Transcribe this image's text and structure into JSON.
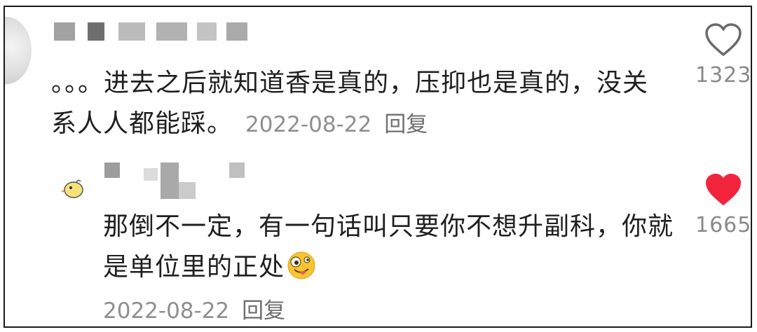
{
  "comments": [
    {
      "text": "。。。进去之后就知道香是真的，压抑也是真的，没关系人人都能踩。",
      "date": "2022-08-22",
      "reply_label": "回复",
      "likes": "1323",
      "liked": false
    },
    {
      "text": "那倒不一定，有一句话叫只要你不想升副科，你就是单位里的正处",
      "date": "2022-08-22",
      "reply_label": "回复",
      "likes": "1665",
      "liked": true
    }
  ],
  "icons": {
    "like_outline": "heart-outline-icon",
    "like_filled": "heart-filled-icon",
    "emoji": "zany-face-emoji"
  },
  "colors": {
    "liked_heart": "#f2243c",
    "meta_text": "#8f8f8f",
    "body_text": "#1f1f1f"
  }
}
